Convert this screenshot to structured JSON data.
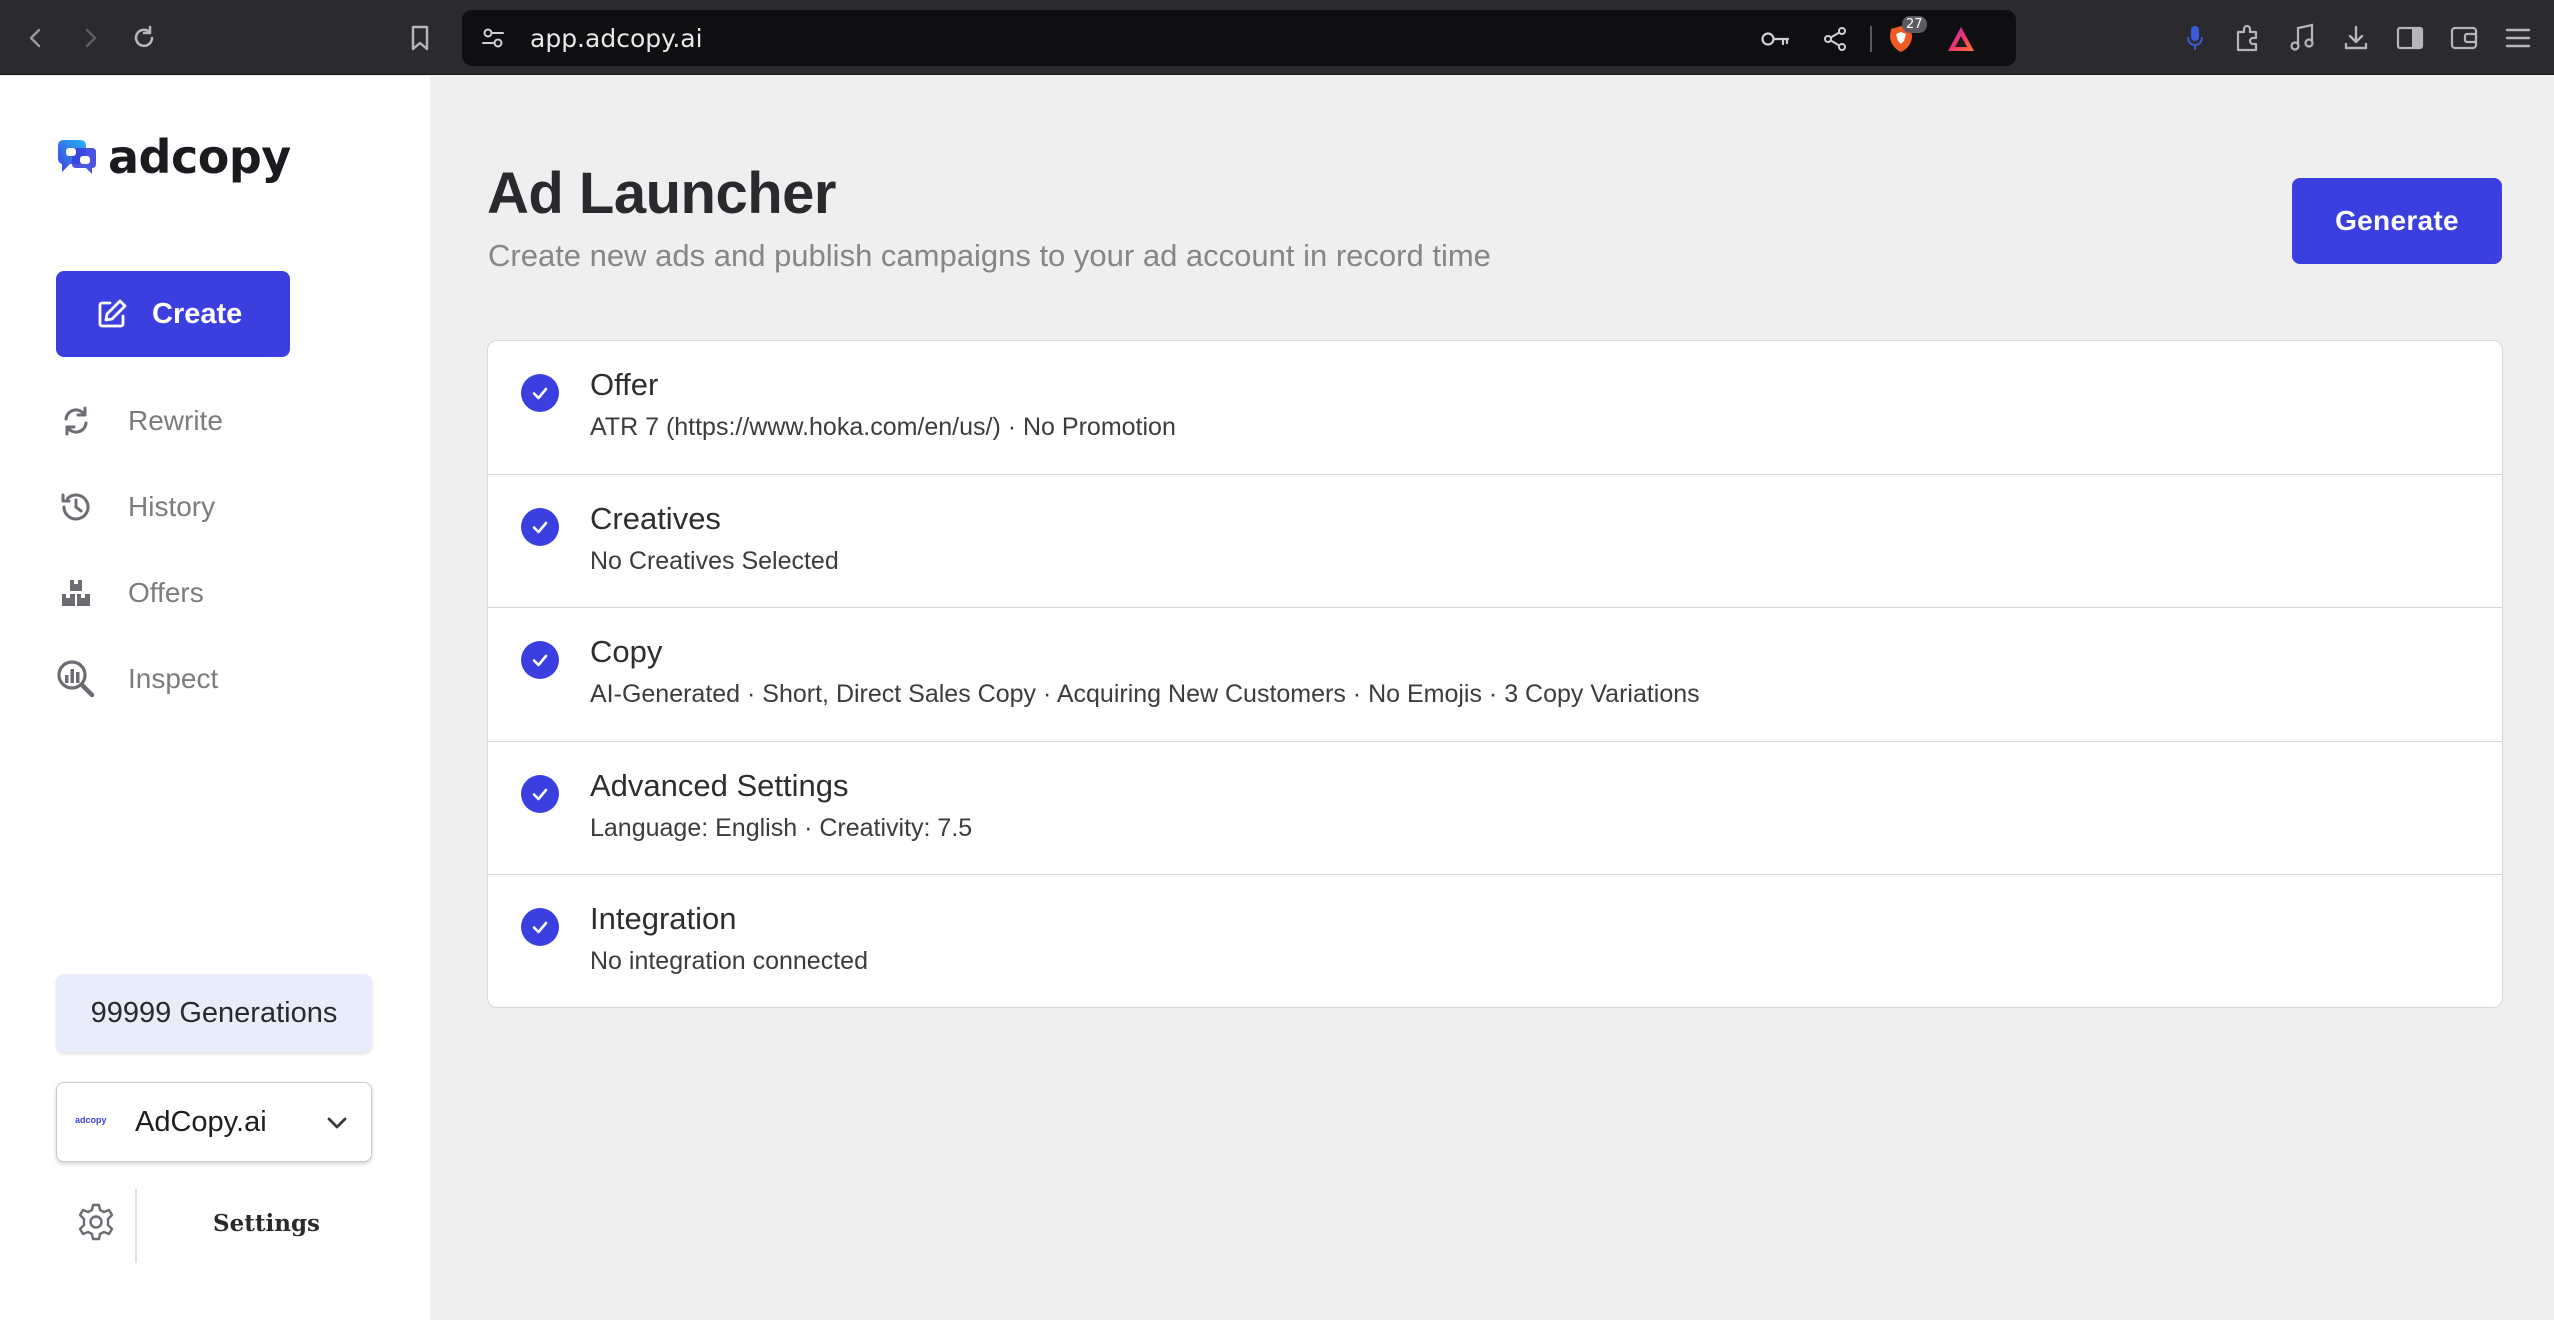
{
  "browser": {
    "url": "app.adcopy.ai",
    "brave_shields_count": "27"
  },
  "sidebar": {
    "logo_text": "adcopy",
    "create_label": "Create",
    "items": [
      {
        "label": "Rewrite",
        "icon": "refresh-icon"
      },
      {
        "label": "History",
        "icon": "history-icon"
      },
      {
        "label": "Offers",
        "icon": "boxes-icon"
      },
      {
        "label": "Inspect",
        "icon": "chart-search-icon"
      }
    ],
    "generations": "99999 Generations",
    "account": {
      "mini_logo": "adcopy",
      "name": "AdCopy.ai"
    },
    "settings_label": "Settings"
  },
  "main": {
    "title": "Ad Launcher",
    "subtitle": "Create new ads and publish campaigns to your ad account in record time",
    "generate_label": "Generate",
    "steps": [
      {
        "name": "Offer",
        "desc": "ATR 7 (https://www.hoka.com/en/us/) · No Promotion",
        "done": true
      },
      {
        "name": "Creatives",
        "desc": "No Creatives Selected",
        "done": true
      },
      {
        "name": "Copy",
        "desc": "AI-Generated · Short, Direct Sales Copy · Acquiring New Customers · No Emojis · 3 Copy Variations",
        "done": true
      },
      {
        "name": "Advanced Settings",
        "desc": "Language: English · Creativity: 7.5",
        "done": true
      },
      {
        "name": "Integration",
        "desc": "No integration connected",
        "done": true
      }
    ]
  },
  "colors": {
    "accent": "#3b3fe0",
    "sidebar_bg": "#ffffff",
    "main_bg": "#efefef",
    "chrome_bg": "#2b2b2f"
  }
}
